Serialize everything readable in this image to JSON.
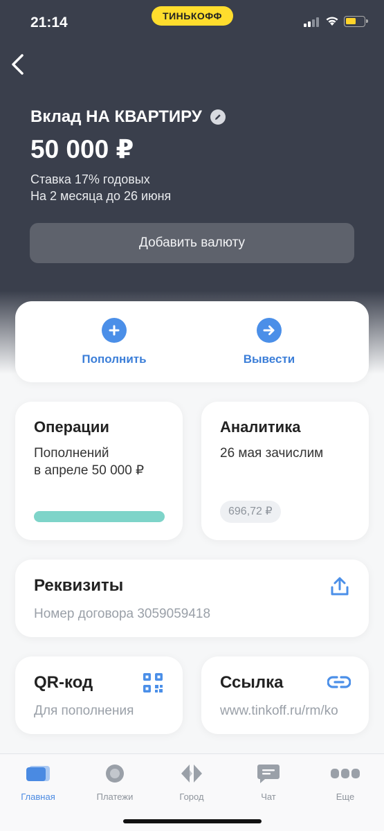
{
  "status_bar": {
    "time": "21:14",
    "brand": "ТИНЬКОФФ"
  },
  "deposit": {
    "title": "Вклад НА КВАРТИРУ",
    "amount": "50 000 ₽",
    "rate": "Ставка 17% годовых",
    "term": "На 2 месяца до 26 июня",
    "add_currency_label": "Добавить валюту"
  },
  "actions": {
    "top_up_label": "Пополнить",
    "withdraw_label": "Вывести"
  },
  "operations": {
    "title": "Операции",
    "line1": "Пополнений",
    "line2": "в апреле 50 000 ₽",
    "progress": 1.0
  },
  "analytics": {
    "title": "Аналитика",
    "text": "26 мая зачислим",
    "chip": "696,72 ₽"
  },
  "requisites": {
    "title": "Реквизиты",
    "contract": "Номер договора 3059059418"
  },
  "qr": {
    "title": "QR-код",
    "subtitle": "Для пополнения"
  },
  "link": {
    "title": "Ссылка",
    "url": "www.tinkoff.ru/rm/ko"
  },
  "tabbar": {
    "items": [
      {
        "label": "Главная",
        "icon": "home-card-icon",
        "active": true
      },
      {
        "label": "Платежи",
        "icon": "payments-icon",
        "active": false
      },
      {
        "label": "Город",
        "icon": "city-icon",
        "active": false
      },
      {
        "label": "Чат",
        "icon": "chat-icon",
        "active": false
      },
      {
        "label": "Еще",
        "icon": "more-icon",
        "active": false
      }
    ]
  },
  "colors": {
    "header_bg": "#3a3f4c",
    "accent": "#4b8fe8",
    "brand_yellow": "#ffdd2d",
    "progress_teal": "#7ed4c9"
  }
}
